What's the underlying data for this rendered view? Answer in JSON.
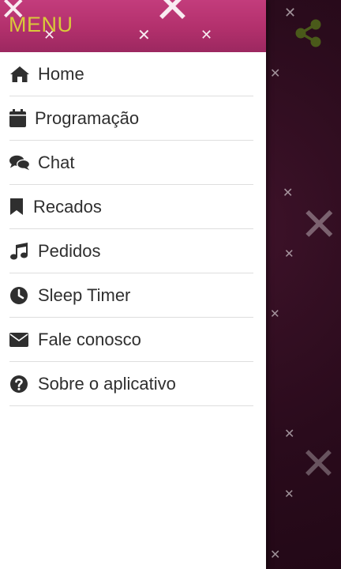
{
  "drawer": {
    "title": "MENU",
    "items": [
      {
        "icon": "home-icon",
        "label": "Home"
      },
      {
        "icon": "calendar-icon",
        "label": "Programação"
      },
      {
        "icon": "chat-icon",
        "label": "Chat"
      },
      {
        "icon": "bookmark-icon",
        "label": "Recados"
      },
      {
        "icon": "music-note-icon",
        "label": "Pedidos"
      },
      {
        "icon": "clock-icon",
        "label": "Sleep Timer"
      },
      {
        "icon": "envelope-icon",
        "label": "Fale conosco"
      },
      {
        "icon": "question-circle-icon",
        "label": "Sobre o aplicativo"
      }
    ]
  },
  "background": {
    "share_icon": "share-icon",
    "share_color": "#4a5a1a"
  },
  "colors": {
    "header_pink": "#b8336f",
    "title_yellow": "#d9c93a",
    "background_dark": "#2a0b1c",
    "text": "#2f2f2f",
    "divider": "#dedede"
  }
}
